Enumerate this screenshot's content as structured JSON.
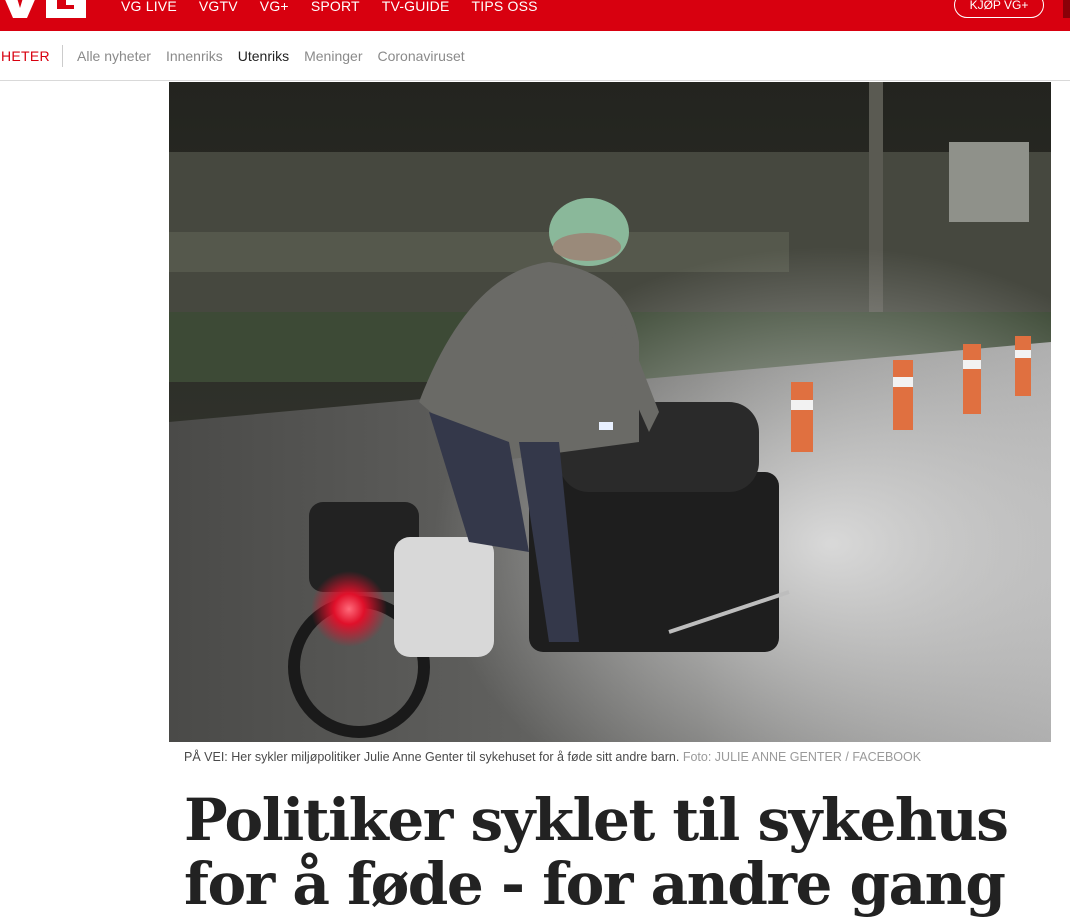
{
  "brand": {
    "logo_text": "VG",
    "brand_color": "#d8000f"
  },
  "top_nav": {
    "items": [
      "VG LIVE",
      "VGTV",
      "VG+",
      "SPORT",
      "TV-GUIDE",
      "TIPS OSS"
    ],
    "buy_button": "KJØP VG+"
  },
  "sub_nav": {
    "section": "HETER",
    "items": [
      {
        "label": "Alle nyheter",
        "active": false
      },
      {
        "label": "Innenriks",
        "active": false
      },
      {
        "label": "Utenriks",
        "active": true
      },
      {
        "label": "Meninger",
        "active": false
      },
      {
        "label": "Coronaviruset",
        "active": false
      }
    ]
  },
  "article": {
    "image_alt": "Kvinne med hjelm sykler lastesykkel om natten",
    "caption": "PÅ VEI: Her sykler miljøpolitiker Julie Anne Genter til sykehuset for å føde sitt andre barn.",
    "credit": "Foto: JULIE ANNE GENTER / FACEBOOK",
    "headline": "Politiker syklet til sykehus for å føde - for andre gang"
  }
}
